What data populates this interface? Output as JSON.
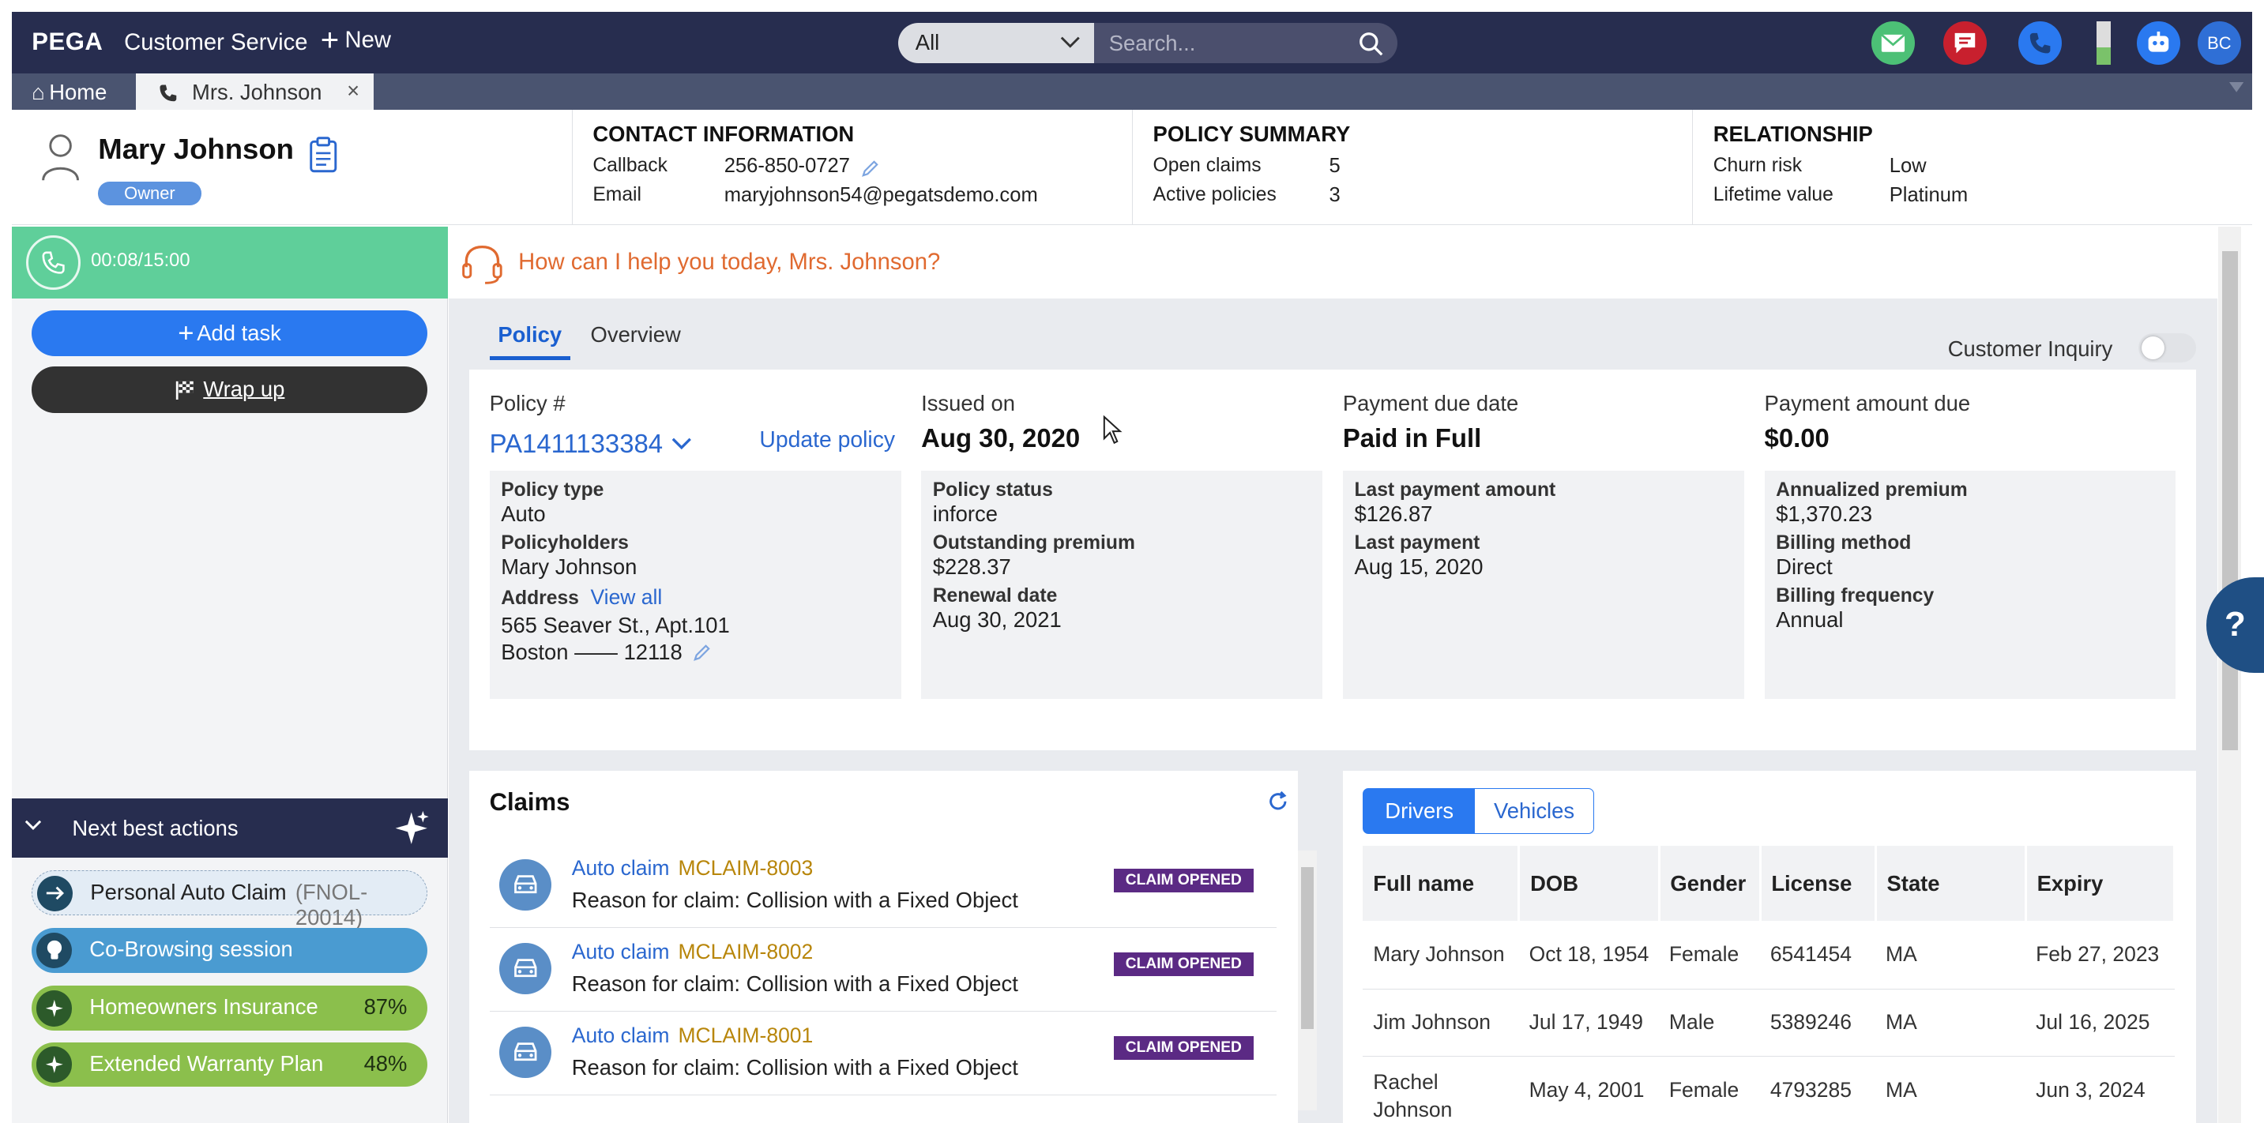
{
  "brand": "PEGA",
  "app_name": "Customer Service",
  "new_label": "New",
  "search": {
    "scope": "All",
    "placeholder": "Search..."
  },
  "user_initials": "BC",
  "tabs": {
    "home": "Home",
    "customer": "Mrs. Johnson",
    "close": "×"
  },
  "customer": {
    "name": "Mary Johnson",
    "role": "Owner"
  },
  "contact": {
    "title": "CONTACT INFORMATION",
    "callback_label": "Callback",
    "callback": "256-850-0727",
    "email_label": "Email",
    "email": "maryjohnson54@pegatsdemo.com"
  },
  "policy_summary": {
    "title": "POLICY SUMMARY",
    "open_claims_label": "Open claims",
    "open_claims": "5",
    "active_policies_label": "Active policies",
    "active_policies": "3"
  },
  "relationship": {
    "title": "RELATIONSHIP",
    "churn_label": "Churn risk",
    "churn": "Low",
    "lifetime_label": "Lifetime value",
    "lifetime": "Platinum"
  },
  "call": {
    "timer": "00:08/15:00"
  },
  "actions": {
    "add_task": "Add task",
    "wrap_up": "Wrap up"
  },
  "nba": {
    "title": "Next best actions",
    "items": [
      {
        "label": "Personal Auto Claim",
        "code": "(FNOL-20014)",
        "color": "#e3ecf5"
      },
      {
        "label": "Co-Browsing session",
        "color": "#4a9bd1"
      },
      {
        "label": "Homeowners Insurance",
        "pct": "87%",
        "color": "#8bbf4c"
      },
      {
        "label": "Extended Warranty Plan",
        "pct": "48%",
        "color": "#8bbf4c"
      }
    ]
  },
  "greeting": "How can I help you today, Mrs. Johnson?",
  "content_tabs": {
    "policy": "Policy",
    "overview": "Overview"
  },
  "customer_inquiry": "Customer Inquiry",
  "policy": {
    "number_label": "Policy #",
    "number": "PA1411133384",
    "update": "Update policy",
    "issued_label": "Issued on",
    "issued": "Aug 30, 2020",
    "due_label": "Payment due date",
    "due": "Paid in Full",
    "amount_label": "Payment amount due",
    "amount": "$0.00",
    "type_label": "Policy type",
    "type": "Auto",
    "holders_label": "Policyholders",
    "holders": "Mary Johnson",
    "address_label": "Address",
    "view_all": "View all",
    "address1": "565 Seaver St., Apt.101",
    "address2": "Boston —— 12118",
    "status_label": "Policy status",
    "status": "inforce",
    "outstanding_label": "Outstanding premium",
    "outstanding": "$228.37",
    "renewal_label": "Renewal date",
    "renewal": "Aug 30, 2021",
    "last_amount_label": "Last payment amount",
    "last_amount": "$126.87",
    "last_payment_label": "Last payment",
    "last_payment": "Aug 15, 2020",
    "premium_label": "Annualized premium",
    "premium": "$1,370.23",
    "billing_method_label": "Billing method",
    "billing_method": "Direct",
    "billing_freq_label": "Billing frequency",
    "billing_freq": "Annual"
  },
  "claims": {
    "title": "Claims",
    "items": [
      {
        "type": "Auto claim",
        "id": "MCLAIM-8003",
        "reason": "Reason for claim:  Collision with a Fixed Object",
        "status": "CLAIM OPENED"
      },
      {
        "type": "Auto claim",
        "id": "MCLAIM-8002",
        "reason": "Reason for claim:  Collision with a Fixed Object",
        "status": "CLAIM OPENED"
      },
      {
        "type": "Auto claim",
        "id": "MCLAIM-8001",
        "reason": "Reason for claim:  Collision with a Fixed Object",
        "status": "CLAIM OPENED"
      }
    ]
  },
  "drivers": {
    "seg_drivers": "Drivers",
    "seg_vehicles": "Vehicles",
    "columns": [
      "Full name",
      "DOB",
      "Gender",
      "License",
      "State",
      "Expiry"
    ],
    "rows": [
      [
        "Mary Johnson",
        "Oct 18, 1954",
        "Female",
        "6541454",
        "MA",
        "Feb 27, 2023"
      ],
      [
        "Jim Johnson",
        "Jul 17, 1949",
        "Male",
        "5389246",
        "MA",
        "Jul 16, 2025"
      ],
      [
        "Rachel Johnson",
        "May 4, 2001",
        "Female",
        "4793285",
        "MA",
        "Jun 3, 2024"
      ]
    ]
  },
  "help": "?"
}
